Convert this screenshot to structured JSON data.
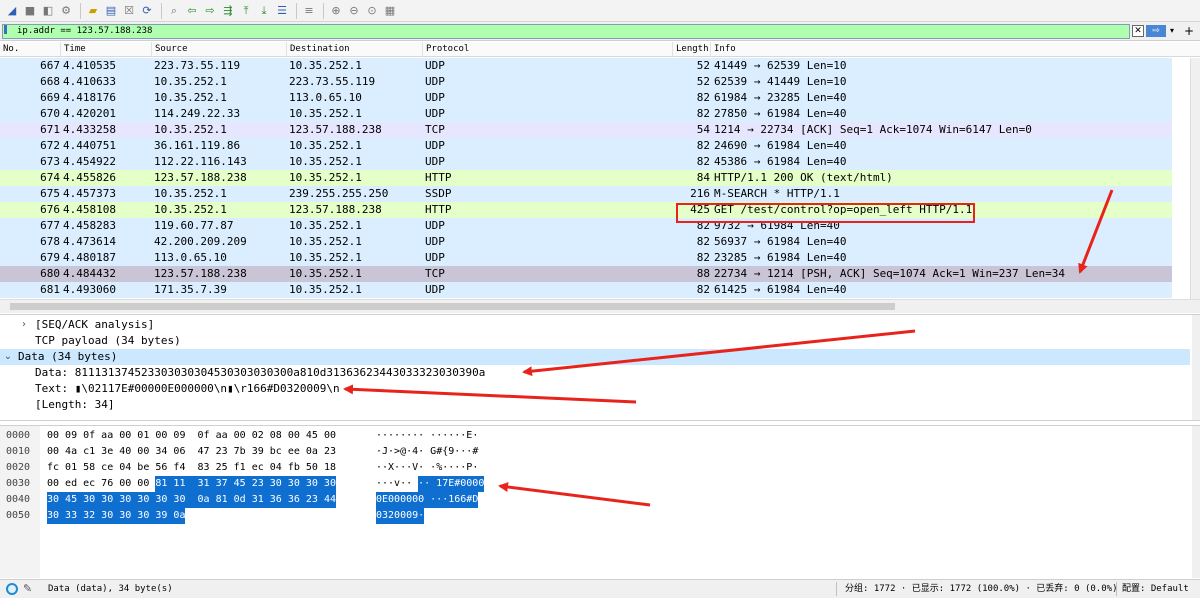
{
  "colors": {
    "udp_row": "#daeeff",
    "tcp_row": "#e7e6ff",
    "http_row": "#e4ffc7",
    "selected_row": "#c9c5d6",
    "filter_ok": "#afffaf",
    "highlight": "#0f6fd1",
    "annotation": "#e8231c"
  },
  "toolbar": {
    "icons": [
      "shark-fin-start-icon",
      "stop-icon",
      "restart-icon",
      "options-gear-icon",
      "open-folder-icon",
      "save-icon",
      "close-file-icon",
      "reload-icon",
      "find-icon",
      "go-back-icon",
      "go-forward-icon",
      "go-to-packet-icon",
      "go-first-icon",
      "go-last-icon",
      "autoscroll-icon",
      "colorize-icon",
      "zoom-in-icon",
      "zoom-out-icon",
      "zoom-normal-icon",
      "resize-columns-icon"
    ]
  },
  "filter": {
    "value": "ip.addr == 123.57.188.238",
    "apply_label": "⇨",
    "add_label": "+"
  },
  "packet_list": {
    "columns": [
      "No.",
      "Time",
      "Source",
      "Destination",
      "Protocol",
      "Length",
      "Info"
    ],
    "rows": [
      {
        "no": "667",
        "time": "4.410535",
        "src": "223.73.55.119",
        "dst": "10.35.252.1",
        "proto": "UDP",
        "len": "52",
        "info": "41449 → 62539 Len=10",
        "kind": "udp"
      },
      {
        "no": "668",
        "time": "4.410633",
        "src": "10.35.252.1",
        "dst": "223.73.55.119",
        "proto": "UDP",
        "len": "52",
        "info": "62539 → 41449 Len=10",
        "kind": "udp"
      },
      {
        "no": "669",
        "time": "4.418176",
        "src": "10.35.252.1",
        "dst": "113.0.65.10",
        "proto": "UDP",
        "len": "82",
        "info": "61984 → 23285 Len=40",
        "kind": "udp"
      },
      {
        "no": "670",
        "time": "4.420201",
        "src": "114.249.22.33",
        "dst": "10.35.252.1",
        "proto": "UDP",
        "len": "82",
        "info": "27850 → 61984 Len=40",
        "kind": "udp"
      },
      {
        "no": "671",
        "time": "4.433258",
        "src": "10.35.252.1",
        "dst": "123.57.188.238",
        "proto": "TCP",
        "len": "54",
        "info": "1214 → 22734 [ACK] Seq=1 Ack=1074 Win=6147 Len=0",
        "kind": "tcp"
      },
      {
        "no": "672",
        "time": "4.440751",
        "src": "36.161.119.86",
        "dst": "10.35.252.1",
        "proto": "UDP",
        "len": "82",
        "info": "24690 → 61984 Len=40",
        "kind": "udp"
      },
      {
        "no": "673",
        "time": "4.454922",
        "src": "112.22.116.143",
        "dst": "10.35.252.1",
        "proto": "UDP",
        "len": "82",
        "info": "45386 → 61984 Len=40",
        "kind": "udp"
      },
      {
        "no": "674",
        "time": "4.455826",
        "src": "123.57.188.238",
        "dst": "10.35.252.1",
        "proto": "HTTP",
        "len": "84",
        "info": "HTTP/1.1 200 OK  (text/html)",
        "kind": "http"
      },
      {
        "no": "675",
        "time": "4.457373",
        "src": "10.35.252.1",
        "dst": "239.255.255.250",
        "proto": "SSDP",
        "len": "216",
        "info": "M-SEARCH * HTTP/1.1",
        "kind": "udp"
      },
      {
        "no": "676",
        "time": "4.458108",
        "src": "10.35.252.1",
        "dst": "123.57.188.238",
        "proto": "HTTP",
        "len": "425",
        "info": "GET /test/control?op=open_left HTTP/1.1",
        "kind": "http"
      },
      {
        "no": "677",
        "time": "4.458283",
        "src": "119.60.77.87",
        "dst": "10.35.252.1",
        "proto": "UDP",
        "len": "82",
        "info": "9732 → 61984 Len=40",
        "kind": "udp"
      },
      {
        "no": "678",
        "time": "4.473614",
        "src": "42.200.209.209",
        "dst": "10.35.252.1",
        "proto": "UDP",
        "len": "82",
        "info": "56937 → 61984 Len=40",
        "kind": "udp"
      },
      {
        "no": "679",
        "time": "4.480187",
        "src": "113.0.65.10",
        "dst": "10.35.252.1",
        "proto": "UDP",
        "len": "82",
        "info": "23285 → 61984 Len=40",
        "kind": "udp"
      },
      {
        "no": "680",
        "time": "4.484432",
        "src": "123.57.188.238",
        "dst": "10.35.252.1",
        "proto": "TCP",
        "len": "88",
        "info": "22734 → 1214 [PSH, ACK] Seq=1074 Ack=1 Win=237 Len=34",
        "kind": "selected"
      },
      {
        "no": "681",
        "time": "4.493060",
        "src": "171.35.7.39",
        "dst": "10.35.252.1",
        "proto": "UDP",
        "len": "82",
        "info": "61425 → 61984 Len=40",
        "kind": "udp"
      }
    ]
  },
  "details": [
    {
      "text": "[SEQ/ACK analysis]",
      "arrow": ">",
      "indent": 1
    },
    {
      "text": "TCP payload (34 bytes)",
      "arrow": "",
      "indent": 1
    },
    {
      "text": "Data (34 bytes)",
      "arrow": "v",
      "indent": 0,
      "selected": true
    },
    {
      "text": "Data: 811131374523303030304530303030300a810d31363623443033323030390a",
      "arrow": "",
      "indent": 2
    },
    {
      "text": "Text: ▮\\02117E#00000E000000\\n▮\\r166#D0320009\\n",
      "arrow": "",
      "indent": 2
    },
    {
      "text": "[Length: 34]",
      "arrow": "",
      "indent": 2
    }
  ],
  "bytes": {
    "rows": [
      {
        "offset": "0000",
        "hex_plain": "00 09 0f aa 00 01 00 09  0f aa 00 02 08 00 45 00",
        "hex_hl": "",
        "ascii_plain": "········ ······E·",
        "ascii_hl": ""
      },
      {
        "offset": "0010",
        "hex_plain": "00 4a c1 3e 40 00 34 06  47 23 7b 39 bc ee 0a 23",
        "hex_hl": "",
        "ascii_plain": "·J·>@·4· G#{9···#",
        "ascii_hl": ""
      },
      {
        "offset": "0020",
        "hex_plain": "fc 01 58 ce 04 be 56 f4  83 25 f1 ec 04 fb 50 18",
        "hex_hl": "",
        "ascii_plain": "··X···V· ·%····P·",
        "ascii_hl": ""
      },
      {
        "offset": "0030",
        "hex_plain": "00 ed ec 76 00 00 ",
        "hex_hl": "81 11  31 37 45 23 30 30 30 30",
        "ascii_plain": "···v·· ",
        "ascii_hl": "·· 17E#0000"
      },
      {
        "offset": "0040",
        "hex_plain": "",
        "hex_hl": "30 45 30 30 30 30 30 30  0a 81 0d 31 36 36 23 44",
        "ascii_plain": "",
        "ascii_hl": "0E000000 ···166#D"
      },
      {
        "offset": "0050",
        "hex_plain": "",
        "hex_hl": "30 33 32 30 30 30 39 0a",
        "ascii_plain": "",
        "ascii_hl": "0320009·"
      }
    ]
  },
  "status": {
    "left": "Data (data), 34 byte(s)",
    "stats": "分组: 1772 · 已显示: 1772 (100.0%) · 已丢弃: 0 (0.0%)",
    "profile": "配置: Default"
  }
}
